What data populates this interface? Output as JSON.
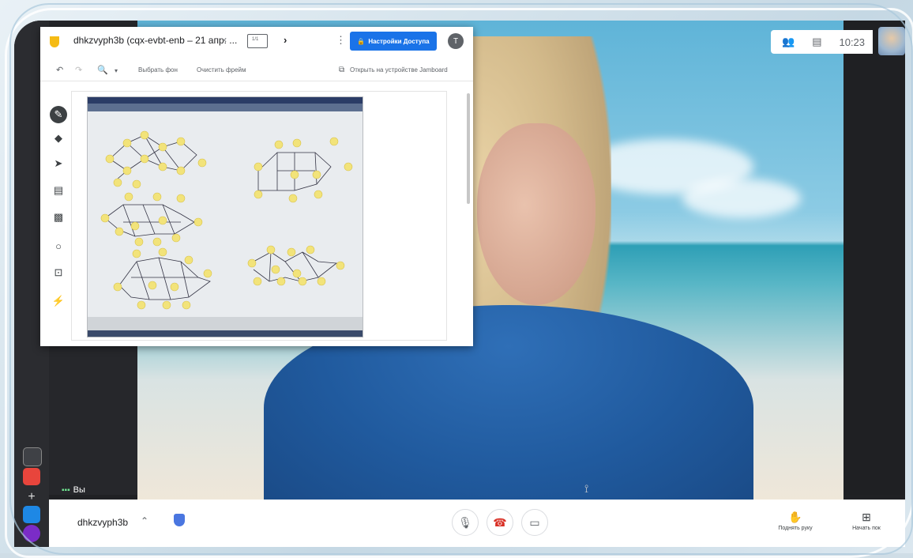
{
  "meeting": {
    "time": "10:23",
    "code": "dhkzvyph3b",
    "you_label": "Вы"
  },
  "jamboard": {
    "title": "dhkzvyph3b (cqx-evbt-enb – 21 апр. ...",
    "frame_counter": "1/1",
    "share_button": "Настройки Доступа",
    "avatar_letter": "T",
    "toolbar": {
      "set_background": "Выбрать фон",
      "clear_frame": "Очистить фрейм",
      "open_on_device": "Открыть на устройстве Jamboard"
    }
  },
  "bottom_bar": {
    "raise_hand": "Поднять руку",
    "start_presentation": "Начать пок"
  },
  "colors": {
    "accent": "#1a73e8",
    "end_call": "#d93025",
    "jam_logo": "#f5bb14",
    "graph_node": "#f2e37a"
  }
}
